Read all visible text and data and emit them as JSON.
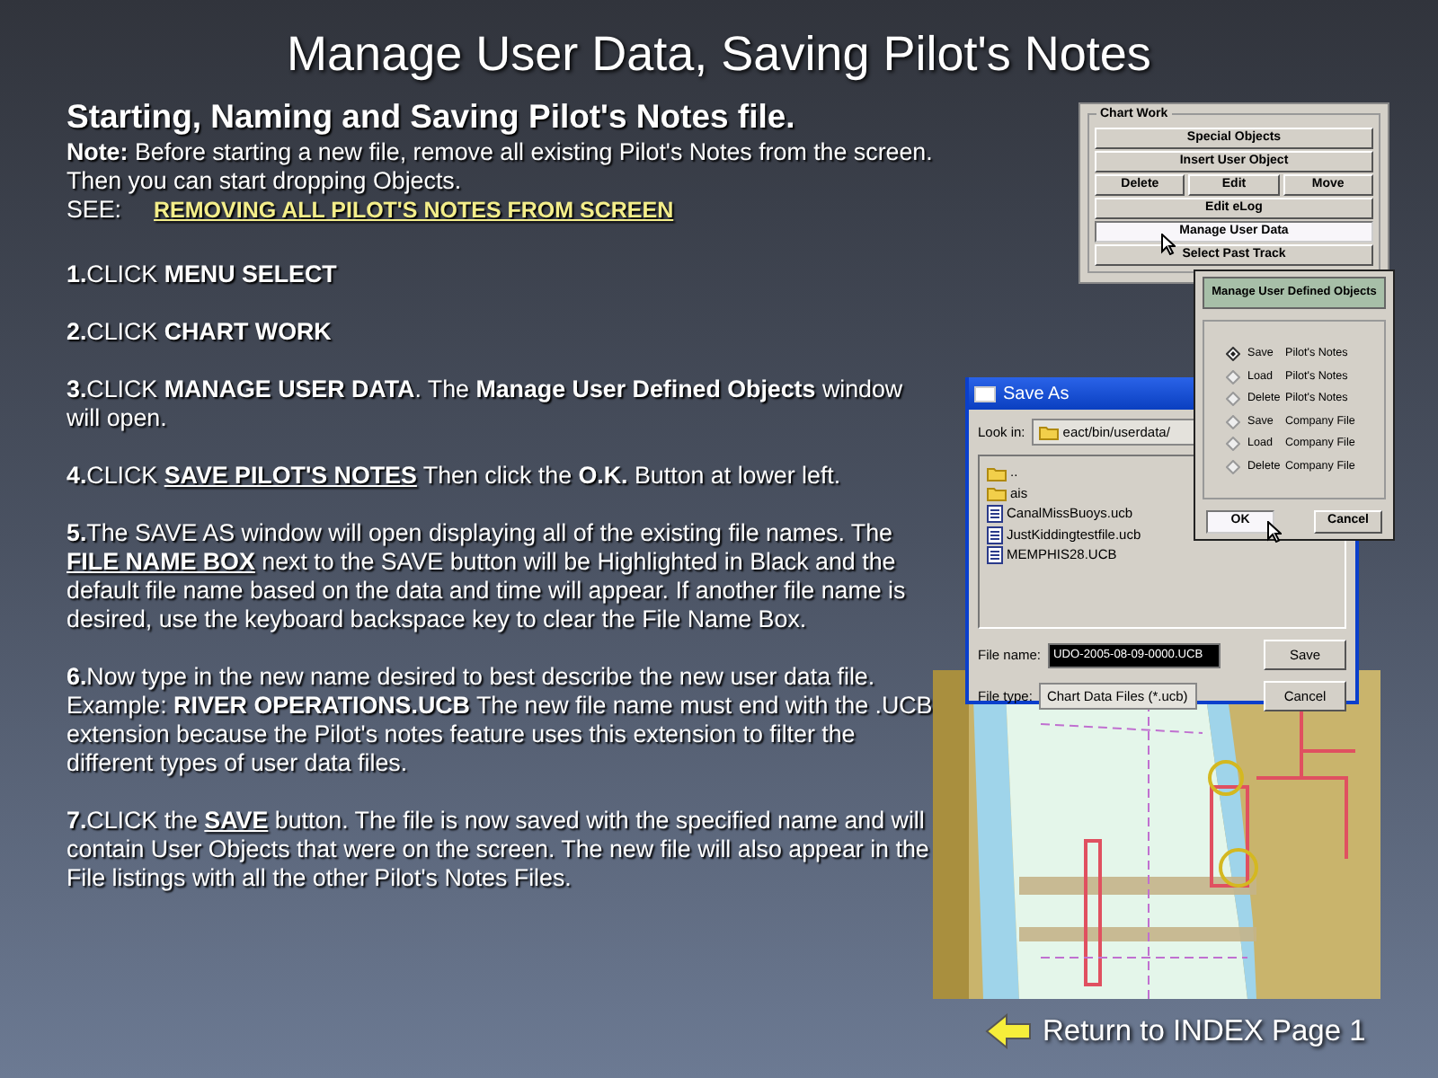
{
  "title": "Manage User Data, Saving Pilot's Notes",
  "heading": "Starting, Naming and Saving Pilot's Notes file.",
  "note": "**Note:**  Before starting a new file, remove all existing Pilot's Notes from the screen.  Then you can start dropping Objects.",
  "see": {
    "label": "SEE:",
    "link": "REMOVING ALL PILOT'S NOTES FROM SCREEN"
  },
  "steps": [
    [
      {
        "text": "1.",
        "bold": true
      },
      {
        "text": "CLICK "
      },
      {
        "text": "MENU SELECT",
        "bold": true
      }
    ],
    [
      {
        "text": "2.",
        "bold": true
      },
      {
        "text": "CLICK "
      },
      {
        "text": "CHART WORK",
        "bold": true
      }
    ],
    [
      {
        "text": "3.",
        "bold": true
      },
      {
        "text": "CLICK "
      },
      {
        "text": "MANAGE USER DATA",
        "bold": true
      },
      {
        "text": ".  The "
      },
      {
        "text": "Manage User Defined Objects",
        "bold": true
      },
      {
        "text": " window will open."
      }
    ],
    [
      {
        "text": "4.",
        "bold": true
      },
      {
        "text": "CLICK "
      },
      {
        "text": "SAVE PILOT'S NOTES",
        "bold": true,
        "underline": true
      },
      {
        "text": " Then click the "
      },
      {
        "text": "O.K.",
        "bold": true
      },
      {
        "text": " Button at lower left."
      }
    ],
    [
      {
        "text": "5.",
        "bold": true
      },
      {
        "text": "The SAVE AS window will open displaying all of the existing file names.  The "
      },
      {
        "text": "FILE NAME BOX",
        "bold": true,
        "underline": true
      },
      {
        "text": " next to the SAVE button will be Highlighted in Black and the default file name based on the data and time will appear.  If another file name is desired, use the keyboard backspace key to clear the File Name Box."
      }
    ],
    [
      {
        "text": "6.",
        "bold": true
      },
      {
        "text": "Now type in the new name desired to best describe the new user data file. Example: "
      },
      {
        "text": "RIVER OPERATIONS.UCB",
        "bold": true
      },
      {
        "text": "     The new file name must end with the .UCB extension because the Pilot's notes feature uses this extension to filter the different types of user data files."
      }
    ],
    [
      {
        "text": "7.",
        "bold": true
      },
      {
        "text": "CLICK the "
      },
      {
        "text": "SAVE",
        "bold": true,
        "underline": true
      },
      {
        "text": " button.  The file is now saved with the specified name and will contain User Objects that were on the screen. The new file will also appear in the File listings with all the other Pilot's Notes Files."
      }
    ]
  ],
  "chart_work": {
    "title": "Chart Work",
    "rows": [
      [
        {
          "label": "Special Objects",
          "selected": false
        }
      ],
      [
        {
          "label": "Insert User Object",
          "selected": false
        }
      ],
      [
        {
          "label": "Delete",
          "selected": false
        },
        {
          "label": "Edit",
          "selected": false
        },
        {
          "label": "Move",
          "selected": false
        }
      ],
      [
        {
          "label": "Edit eLog",
          "selected": false
        }
      ],
      [
        {
          "label": "Manage User Data",
          "selected": true
        }
      ],
      [
        {
          "label": "Select Past Track",
          "selected": false
        }
      ]
    ]
  },
  "manage_dialog": {
    "title": "Manage User Defined Objects",
    "options": [
      {
        "verb": "Save",
        "object": "Pilot's Notes",
        "selected": true
      },
      {
        "verb": "Load",
        "object": "Pilot's Notes",
        "selected": false
      },
      {
        "verb": "Delete",
        "object": "Pilot's Notes",
        "selected": false
      },
      {
        "verb": "Save",
        "object": "Company File",
        "selected": false
      },
      {
        "verb": "Load",
        "object": "Company File",
        "selected": false
      },
      {
        "verb": "Delete",
        "object": "Company File",
        "selected": false
      }
    ],
    "buttons": [
      {
        "label": "OK",
        "focused": true
      },
      {
        "label": "Cancel",
        "focused": false
      }
    ]
  },
  "save_as": {
    "title": "Save As",
    "look_in": {
      "label": "Look in:",
      "value": "eact/bin/userdata/"
    },
    "files": [
      {
        "name": "..",
        "kind": "folder"
      },
      {
        "name": "ais",
        "kind": "folder"
      },
      {
        "name": "CanalMissBuoys.ucb",
        "kind": "file"
      },
      {
        "name": "JustKiddingtestfile.ucb",
        "kind": "file"
      },
      {
        "name": "MEMPHIS28.UCB",
        "kind": "file"
      }
    ],
    "file_name": {
      "label": "File name:",
      "value": "UDO-2005-08-09-0000.UCB",
      "highlighted": true
    },
    "file_type": {
      "label": "File type:",
      "value": "Chart Data Files (*.ucb)"
    },
    "buttons": [
      "Save",
      "Cancel"
    ]
  },
  "return_link": "Return to INDEX Page 1"
}
